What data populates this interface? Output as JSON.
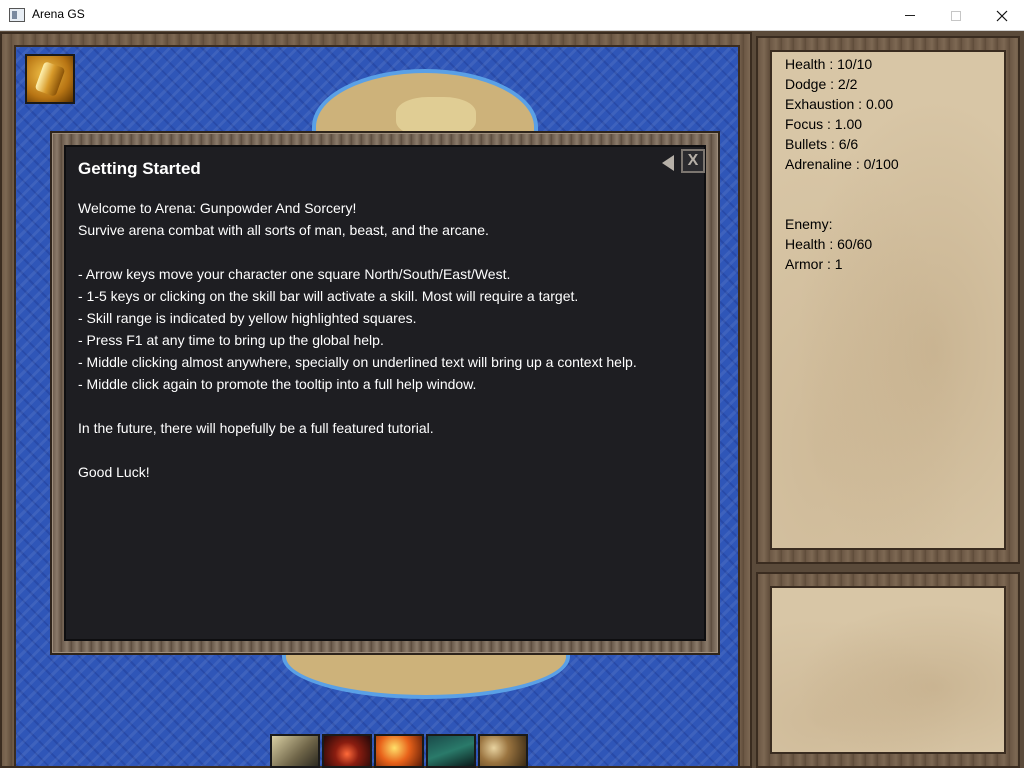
{
  "window": {
    "title": "Arena GS"
  },
  "dialog": {
    "title": "Getting Started",
    "close_label": "X",
    "lines": [
      "Welcome to Arena: Gunpowder And Sorcery!",
      "Survive arena combat with all sorts of man, beast, and the arcane.",
      "",
      "- Arrow keys move your character one square North/South/East/West.",
      "- 1-5 keys or clicking on the skill bar will activate a skill. Most will require a target.",
      "- Skill range is indicated by yellow highlighted squares.",
      "- Press F1 at any time to bring up the global help.",
      "- Middle clicking almost anywhere, specially on underlined text will bring up a context help.",
      "- Middle click again to promote the tooltip into a full help window.",
      "",
      "In the future, there will hopefully be a full featured tutorial.",
      "",
      "Good Luck!"
    ]
  },
  "player_stats": [
    "Health : 10/10",
    "Dodge : 2/2",
    "Exhaustion : 0.00",
    "Focus : 1.00",
    "Bullets : 6/6",
    "Adrenaline : 0/100",
    "",
    "",
    "Enemy:",
    "Health : 60/60",
    "Armor : 1"
  ],
  "skills": [
    {
      "icon": "musket-skill-icon"
    },
    {
      "icon": "bomb-skill-icon"
    },
    {
      "icon": "fire-shot-skill-icon"
    },
    {
      "icon": "dash-skill-icon"
    },
    {
      "icon": "bullets-skill-icon"
    }
  ],
  "colors": {
    "water": "#2f56b8",
    "sand": "#cdb27a",
    "dialog_bg": "#1e1e22",
    "parchment": "#d8c6a6",
    "frame_wood": "#6b5744"
  }
}
